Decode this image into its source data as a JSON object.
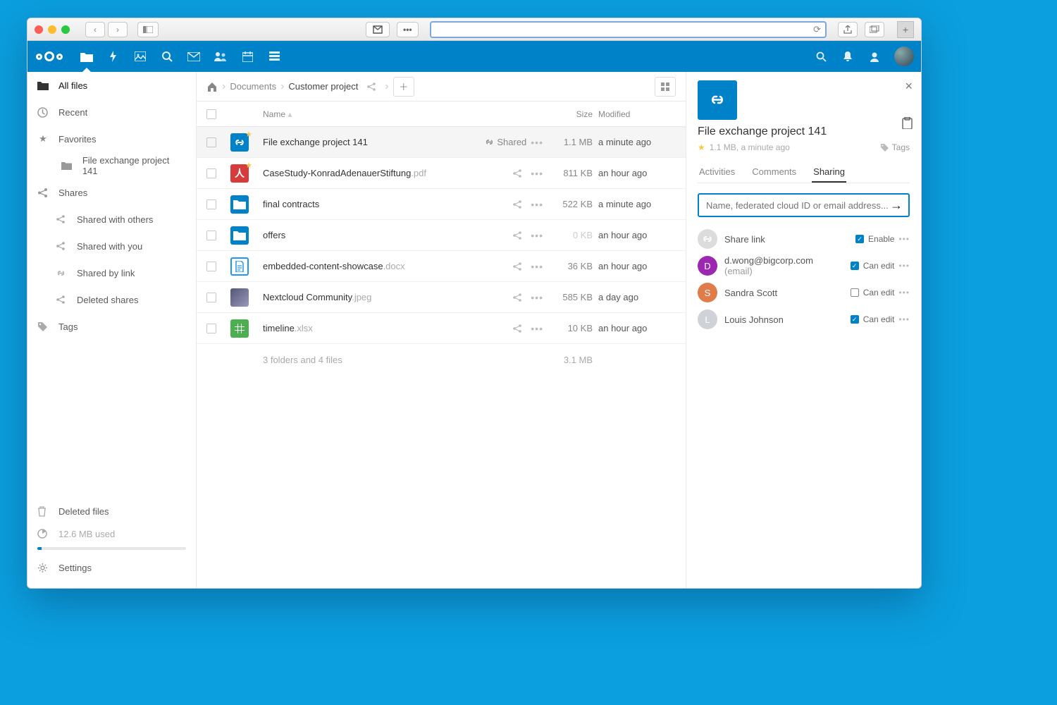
{
  "sidebar": {
    "all_files": "All files",
    "recent": "Recent",
    "favorites": "Favorites",
    "fav_project": "File exchange project 141",
    "shares": "Shares",
    "shared_with_others": "Shared with others",
    "shared_with_you": "Shared with you",
    "shared_by_link": "Shared by link",
    "deleted_shares": "Deleted shares",
    "tags": "Tags",
    "deleted_files": "Deleted files",
    "quota": "12.6 MB used",
    "settings": "Settings"
  },
  "breadcrumb": {
    "documents": "Documents",
    "current": "Customer project"
  },
  "headers": {
    "name": "Name",
    "size": "Size",
    "modified": "Modified"
  },
  "files": [
    {
      "name": "File exchange project 141",
      "ext": "",
      "type": "share",
      "starred": true,
      "shared_label": "Shared",
      "size": "1.1 MB",
      "modified": "a minute ago",
      "selected": true
    },
    {
      "name": "CaseStudy-KonradAdenauerStiftung",
      "ext": ".pdf",
      "type": "pdf",
      "starred": true,
      "size": "811 KB",
      "modified": "an hour ago"
    },
    {
      "name": "final contracts",
      "ext": "",
      "type": "folder",
      "size": "522 KB",
      "modified": "a minute ago"
    },
    {
      "name": "offers",
      "ext": "",
      "type": "folder",
      "size": "0 KB",
      "modified": "an hour ago"
    },
    {
      "name": "embedded-content-showcase",
      "ext": ".docx",
      "type": "doc",
      "size": "36 KB",
      "modified": "an hour ago"
    },
    {
      "name": "Nextcloud Community",
      "ext": ".jpeg",
      "type": "img",
      "size": "585 KB",
      "modified": "a day ago"
    },
    {
      "name": "timeline",
      "ext": ".xlsx",
      "type": "xls",
      "size": "10 KB",
      "modified": "an hour ago"
    }
  ],
  "summary": {
    "text": "3 folders and 4 files",
    "total": "3.1 MB"
  },
  "details": {
    "title": "File exchange project 141",
    "meta": "1.1 MB, a minute ago",
    "tags_label": "Tags",
    "tabs": {
      "activities": "Activities",
      "comments": "Comments",
      "sharing": "Sharing"
    },
    "search_placeholder": "Name, federated cloud ID or email address...",
    "share_link": "Share link",
    "enable": "Enable",
    "can_edit": "Can edit",
    "people": [
      {
        "name": "d.wong@bigcorp.com",
        "suffix": " (email)",
        "initial": "D",
        "color": "#9c27b0",
        "can_edit": true
      },
      {
        "name": "Sandra Scott",
        "initial": "S",
        "color": "#e07b4a",
        "can_edit": false
      },
      {
        "name": "Louis Johnson",
        "initial": "L",
        "color": "#cfd2d6",
        "can_edit": true
      }
    ]
  }
}
